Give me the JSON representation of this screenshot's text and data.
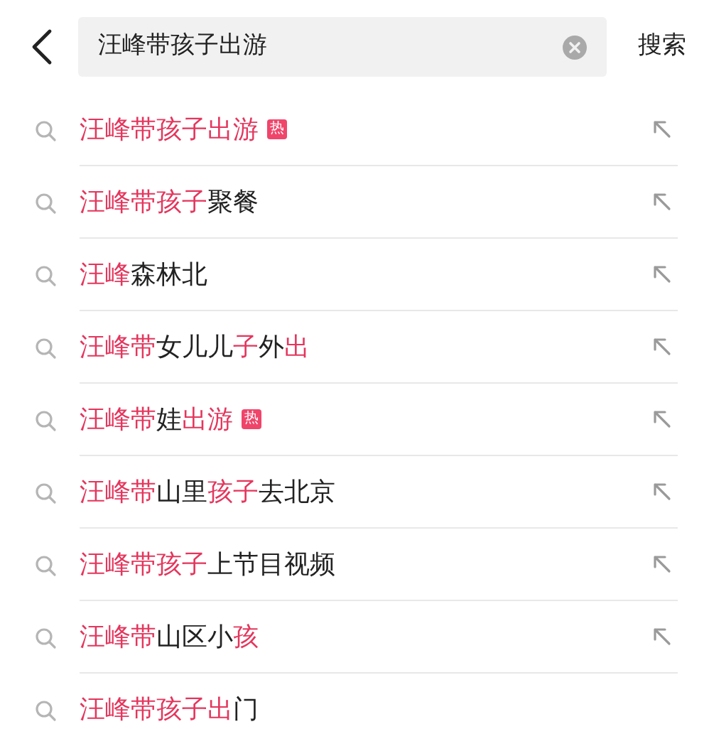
{
  "search": {
    "value": "汪峰带孩子出游",
    "button": "搜索"
  },
  "suggestions": [
    {
      "segments": [
        {
          "text": "汪峰带孩子出游",
          "match": true
        }
      ],
      "badge": "热",
      "arrow": true
    },
    {
      "segments": [
        {
          "text": "汪峰带孩子",
          "match": true
        },
        {
          "text": "聚餐",
          "match": false
        }
      ],
      "arrow": true
    },
    {
      "segments": [
        {
          "text": "汪峰",
          "match": true
        },
        {
          "text": "森林北",
          "match": false
        }
      ],
      "arrow": true
    },
    {
      "segments": [
        {
          "text": "汪峰带",
          "match": true
        },
        {
          "text": "女儿儿",
          "match": false
        },
        {
          "text": "子",
          "match": true
        },
        {
          "text": "外",
          "match": false
        },
        {
          "text": "出",
          "match": true
        }
      ],
      "arrow": true
    },
    {
      "segments": [
        {
          "text": "汪峰带",
          "match": true
        },
        {
          "text": "娃",
          "match": false
        },
        {
          "text": "出游",
          "match": true
        }
      ],
      "badge": "热",
      "arrow": true
    },
    {
      "segments": [
        {
          "text": "汪峰带",
          "match": true
        },
        {
          "text": "山里",
          "match": false
        },
        {
          "text": "孩子",
          "match": true
        },
        {
          "text": "去北京",
          "match": false
        }
      ],
      "arrow": true
    },
    {
      "segments": [
        {
          "text": "汪峰带孩子",
          "match": true
        },
        {
          "text": "上节目视频",
          "match": false
        }
      ],
      "arrow": true
    },
    {
      "segments": [
        {
          "text": "汪峰带",
          "match": true
        },
        {
          "text": "山区小",
          "match": false
        },
        {
          "text": "孩",
          "match": true
        }
      ],
      "arrow": true
    },
    {
      "segments": [
        {
          "text": "汪峰带孩子出",
          "match": true
        },
        {
          "text": "门",
          "match": false
        }
      ],
      "arrow": false
    }
  ]
}
